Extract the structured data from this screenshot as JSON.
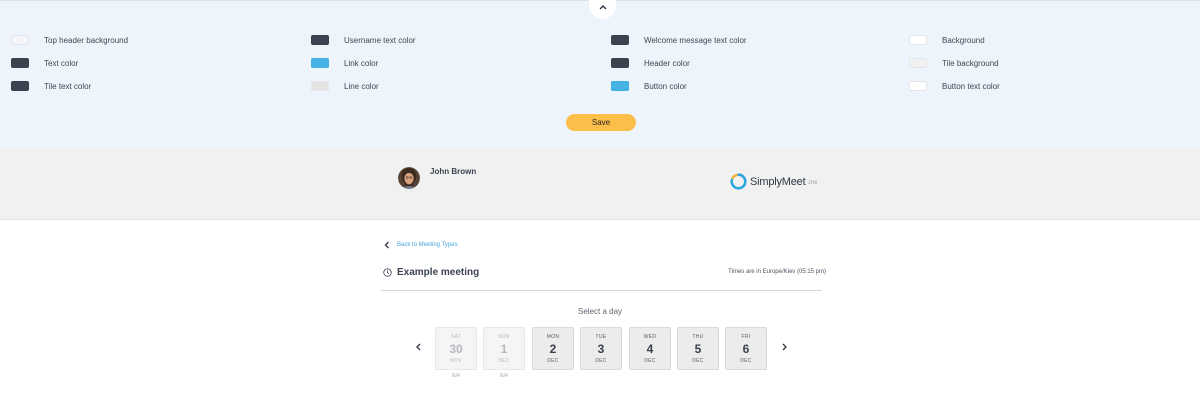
{
  "settings": {
    "colors": [
      {
        "label": "Top header background",
        "color": "#f4f6f9"
      },
      {
        "label": "Username text color",
        "color": "#3c4350"
      },
      {
        "label": "Welcome message text color",
        "color": "#3c4350"
      },
      {
        "label": "Background",
        "color": "#ffffff"
      },
      {
        "label": "Text color",
        "color": "#3c4350"
      },
      {
        "label": "Link color",
        "color": "#45b3e6"
      },
      {
        "label": "Header color",
        "color": "#3c4350"
      },
      {
        "label": "Tile background",
        "color": "#f1f1f1"
      },
      {
        "label": "Tile text color",
        "color": "#3c4350"
      },
      {
        "label": "Line color",
        "color": "#e3e3e3"
      },
      {
        "label": "Button color",
        "color": "#45b3e6"
      },
      {
        "label": "Button text color",
        "color": "#ffffff"
      }
    ],
    "save_label": "Save",
    "collapse_icon": "chevron-up-icon",
    "save_color": "#fbbe48"
  },
  "header": {
    "username": "John Brown",
    "logo_text": "SimplyMeet",
    "logo_sub": ".me",
    "logo_color": "#2aa6e0"
  },
  "booking": {
    "back_label": "Back to Meeting Types",
    "meeting_title": "Example meeting",
    "timezone": "Times are in Europe/Kiev (05:15 pm)",
    "select_day_label": "Select a day",
    "days": [
      {
        "dow": "SAT",
        "num": "30",
        "month": "NOV",
        "available": false,
        "note": "N/A"
      },
      {
        "dow": "SUN",
        "num": "1",
        "month": "DEC",
        "available": false,
        "note": "N/A"
      },
      {
        "dow": "MON",
        "num": "2",
        "month": "DEC",
        "available": true,
        "note": ""
      },
      {
        "dow": "TUE",
        "num": "3",
        "month": "DEC",
        "available": true,
        "note": ""
      },
      {
        "dow": "WED",
        "num": "4",
        "month": "DEC",
        "available": true,
        "note": ""
      },
      {
        "dow": "THU",
        "num": "5",
        "month": "DEC",
        "available": true,
        "note": ""
      },
      {
        "dow": "FRI",
        "num": "6",
        "month": "DEC",
        "available": true,
        "note": ""
      }
    ]
  }
}
